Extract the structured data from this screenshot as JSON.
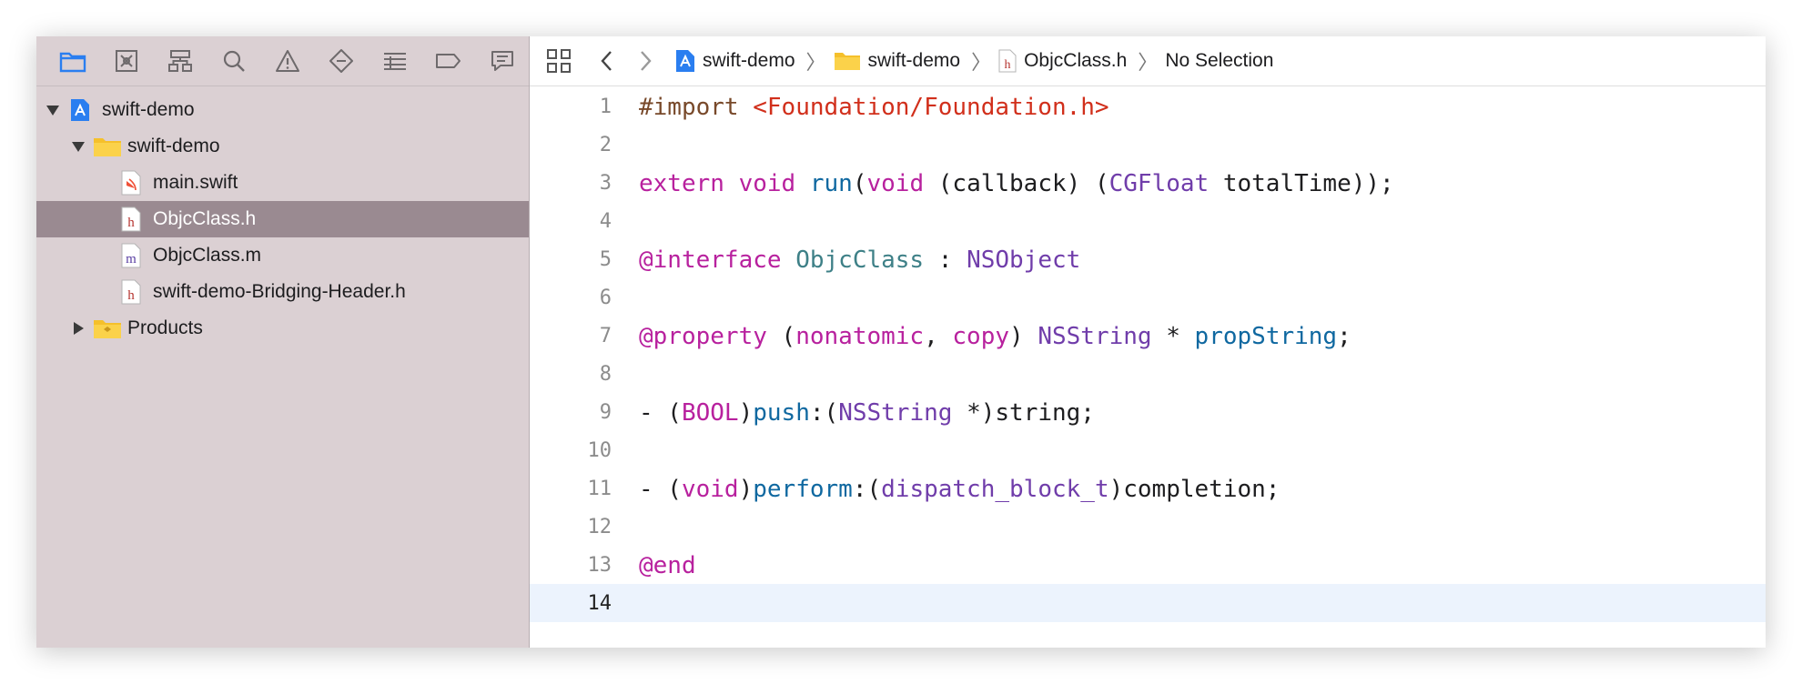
{
  "colors": {
    "sidebar_bg": "#dbd0d3",
    "selection_bg": "#9a8a91",
    "keyword": "#b8219e",
    "preprocessor": "#78492a",
    "string": "#d12f1b",
    "type": "#703daa",
    "function_decl": "#3e8087",
    "method": "#0f68a0",
    "current_line": "#ecf3fd",
    "accent": "#2a7ef0"
  },
  "navigator": {
    "tabs": [
      {
        "icon": "folder-icon",
        "active": true
      },
      {
        "icon": "source-control-icon"
      },
      {
        "icon": "symbol-hierarchy-icon"
      },
      {
        "icon": "search-icon"
      },
      {
        "icon": "warning-icon"
      },
      {
        "icon": "test-diamond-icon"
      },
      {
        "icon": "debug-list-icon"
      },
      {
        "icon": "breakpoint-icon"
      },
      {
        "icon": "report-icon"
      }
    ],
    "tree": [
      {
        "label": "swift-demo",
        "kind": "project",
        "level": 0,
        "expanded": true
      },
      {
        "label": "swift-demo",
        "kind": "folder",
        "level": 1,
        "expanded": true
      },
      {
        "label": "main.swift",
        "kind": "swift",
        "level": 2
      },
      {
        "label": "ObjcClass.h",
        "kind": "h",
        "level": 2,
        "selected": true
      },
      {
        "label": "ObjcClass.m",
        "kind": "m",
        "level": 2
      },
      {
        "label": "swift-demo-Bridging-Header.h",
        "kind": "h",
        "level": 2
      },
      {
        "label": "Products",
        "kind": "folder",
        "level": 1,
        "expanded": false
      }
    ]
  },
  "jumpbar": {
    "crumbs": [
      {
        "label": "swift-demo",
        "icon": "project-icon"
      },
      {
        "label": "swift-demo",
        "icon": "folder-icon"
      },
      {
        "label": "ObjcClass.h",
        "icon": "header-file-icon"
      },
      {
        "label": "No Selection",
        "icon": ""
      }
    ]
  },
  "editor": {
    "current_line": 14,
    "lines": [
      {
        "n": "1",
        "tokens": [
          [
            "pre",
            "#import "
          ],
          [
            "str",
            "<Foundation/Foundation.h>"
          ]
        ]
      },
      {
        "n": "2",
        "tokens": []
      },
      {
        "n": "3",
        "tokens": [
          [
            "kw",
            "extern"
          ],
          [
            "txt",
            " "
          ],
          [
            "kw",
            "void"
          ],
          [
            "txt",
            " "
          ],
          [
            "mth",
            "run"
          ],
          [
            "txt",
            "("
          ],
          [
            "kw",
            "void"
          ],
          [
            "txt",
            " (callback) ("
          ],
          [
            "typ",
            "CGFloat"
          ],
          [
            "txt",
            " totalTime));"
          ]
        ]
      },
      {
        "n": "4",
        "tokens": []
      },
      {
        "n": "5",
        "tokens": [
          [
            "kw",
            "@interface"
          ],
          [
            "txt",
            " "
          ],
          [
            "fn",
            "ObjcClass"
          ],
          [
            "txt",
            " : "
          ],
          [
            "typ",
            "NSObject"
          ]
        ]
      },
      {
        "n": "6",
        "tokens": []
      },
      {
        "n": "7",
        "tokens": [
          [
            "kw",
            "@property"
          ],
          [
            "txt",
            " ("
          ],
          [
            "kw",
            "nonatomic"
          ],
          [
            "txt",
            ", "
          ],
          [
            "kw",
            "copy"
          ],
          [
            "txt",
            ") "
          ],
          [
            "typ",
            "NSString"
          ],
          [
            "txt",
            " * "
          ],
          [
            "mth",
            "propString"
          ],
          [
            "txt",
            ";"
          ]
        ]
      },
      {
        "n": "8",
        "tokens": []
      },
      {
        "n": "9",
        "tokens": [
          [
            "txt",
            "- ("
          ],
          [
            "kw",
            "BOOL"
          ],
          [
            "txt",
            ")"
          ],
          [
            "mth",
            "push"
          ],
          [
            "txt",
            ":("
          ],
          [
            "typ",
            "NSString"
          ],
          [
            "txt",
            " *)string;"
          ]
        ]
      },
      {
        "n": "10",
        "tokens": []
      },
      {
        "n": "11",
        "tokens": [
          [
            "txt",
            "- ("
          ],
          [
            "kw",
            "void"
          ],
          [
            "txt",
            ")"
          ],
          [
            "mth",
            "perform"
          ],
          [
            "txt",
            ":("
          ],
          [
            "typ",
            "dispatch_block_t"
          ],
          [
            "txt",
            ")completion;"
          ]
        ]
      },
      {
        "n": "12",
        "tokens": []
      },
      {
        "n": "13",
        "tokens": [
          [
            "kw",
            "@end"
          ]
        ]
      },
      {
        "n": "14",
        "tokens": []
      }
    ]
  }
}
